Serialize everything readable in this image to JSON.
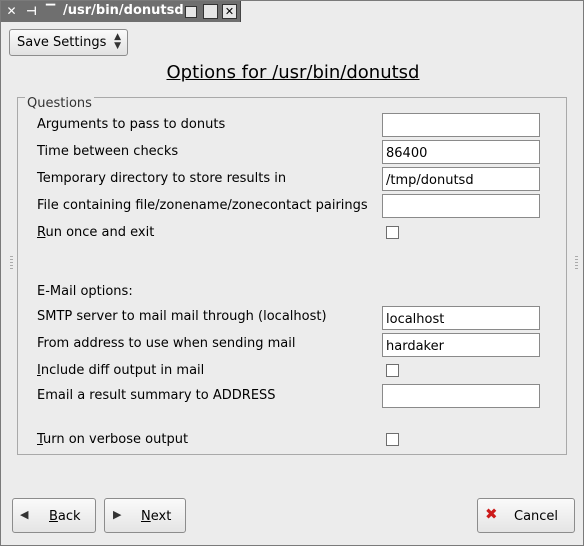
{
  "window": {
    "title": "/usr/bin/donutsd"
  },
  "toolbar": {
    "combo_value": "Save Settings"
  },
  "heading": "Options for /usr/bin/donutsd",
  "questions": {
    "group_label": "Questions",
    "arguments_label": "Arguments to pass to donuts",
    "arguments_value": "",
    "interval_label": "Time between checks",
    "interval_value": "86400",
    "tmpdir_label": "Temporary directory to store results in",
    "tmpdir_value": "/tmp/donutsd",
    "zonefile_label": "File containing file/zonename/zonecontact pairings",
    "zonefile_value": "",
    "runonce_mnemonic": "R",
    "runonce_rest": "un once and exit",
    "email_section": "E-Mail options:",
    "smtp_label": "SMTP server to mail mail through (localhost)",
    "smtp_value": "localhost",
    "from_label": "From address to use when sending mail",
    "from_value": "hardaker",
    "diff_mnemonic": "I",
    "diff_rest": "nclude diff output in mail",
    "summary_label": "Email a result summary to ADDRESS",
    "summary_value": "",
    "verbose_mnemonic": "T",
    "verbose_rest": "urn on verbose output"
  },
  "buttons": {
    "back_mnemonic": "B",
    "back_rest": "ack",
    "next_mnemonic": "N",
    "next_rest": "ext",
    "cancel": "Cancel"
  }
}
